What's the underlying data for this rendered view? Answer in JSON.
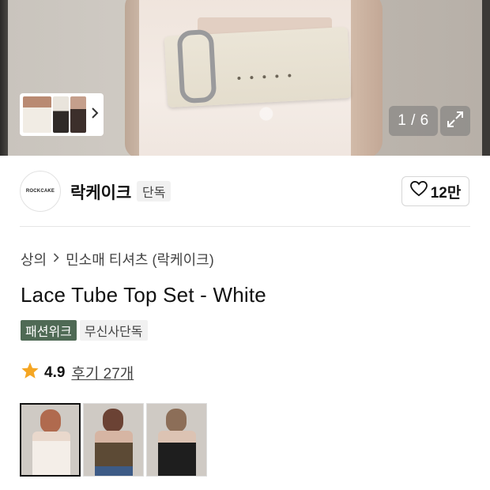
{
  "gallery": {
    "counter": "1 / 6",
    "current_index": 1,
    "total": 6
  },
  "brand": {
    "logo_text": "ROCKCAKE",
    "name": "락케이크",
    "badge": "단독",
    "like_count": "12만"
  },
  "breadcrumb": {
    "category": "상의",
    "subcategory": "민소매 티셔츠 (락케이크)"
  },
  "product": {
    "title": "Lace Tube Top Set - White",
    "tags": [
      "패션위크",
      "무신사단독"
    ],
    "rating": "4.9",
    "reviews": "후기 27개"
  },
  "colors": {
    "accent_green": "#4f6a55",
    "star": "#f5a623"
  },
  "icons": {
    "gallery_next": "chevron-right-icon",
    "expand": "expand-icon",
    "like": "heart-icon",
    "breadcrumb_sep": "chevron-right-icon",
    "rating": "star-icon"
  }
}
